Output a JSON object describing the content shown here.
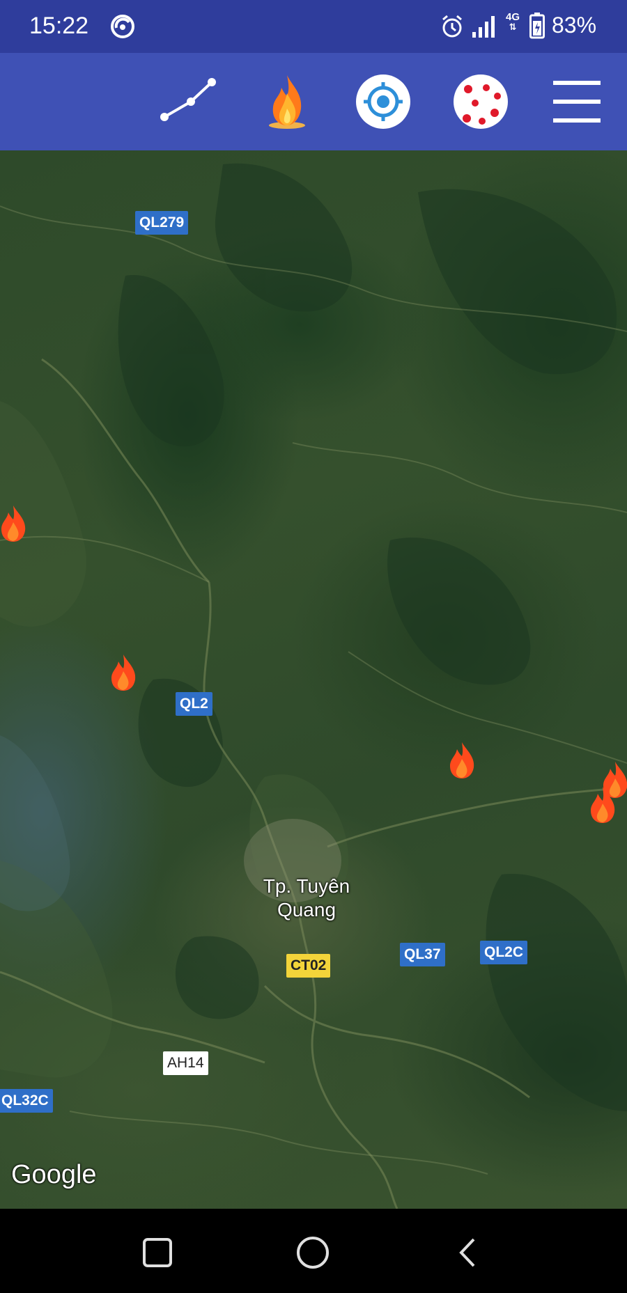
{
  "status_bar": {
    "time": "15:22",
    "network": "4G",
    "battery_percent": "83%",
    "icons": [
      "app-notification-icon",
      "alarm-icon",
      "signal-icon",
      "battery-icon"
    ]
  },
  "toolbar": {
    "buttons": [
      "measure-distance-icon",
      "fire-icon",
      "my-location-icon",
      "hotspots-icon",
      "menu-icon"
    ],
    "accent_color": "#3f51b5"
  },
  "map": {
    "road_labels": {
      "ql279": "QL279",
      "ql2": "QL2",
      "ql37": "QL37",
      "ql2c": "QL2C",
      "ct02": "CT02",
      "ah14": "AH14",
      "ql32c": "QL32C"
    },
    "city_label": "Tp. Tuyên Quang",
    "attribution": "Google",
    "fire_marker_color": "#ff4a1c",
    "fire_marker_count": 5
  },
  "nav_bar": {
    "buttons": [
      "recents-icon",
      "home-icon",
      "back-icon"
    ]
  }
}
